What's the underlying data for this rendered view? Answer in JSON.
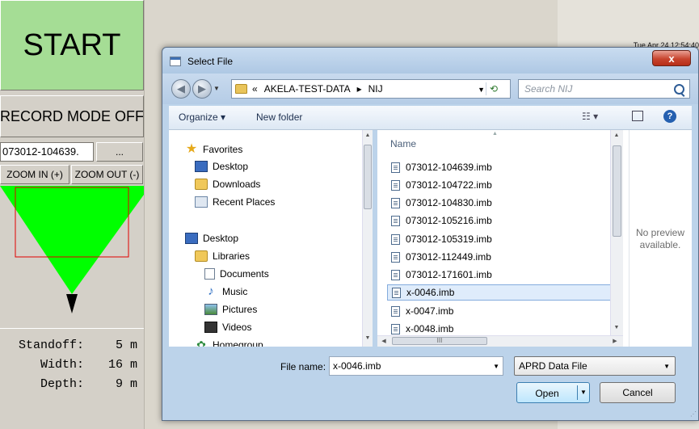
{
  "background_app": {
    "start_label": "START",
    "record_mode_label": "RECORD MODE OFF",
    "file_field_value": "073012-104639.",
    "browse_label": "...",
    "zoom_in_label": "ZOOM IN (+)",
    "zoom_out_label": "ZOOM OUT (-)",
    "readouts": [
      {
        "label": "Standoff:",
        "value": "5 m"
      },
      {
        "label": "Width:",
        "value": "16 m"
      },
      {
        "label": "Depth:",
        "value": "9 m"
      }
    ],
    "clock": "Tue Apr 24 12:54:40",
    "colors": {
      "start_bg": "#a5dd95",
      "fov_fill": "#00ff00",
      "fov_box": "#e00000"
    }
  },
  "dialog": {
    "title": "Select File",
    "close_label": "x",
    "address": {
      "prefix": "«",
      "crumbs": [
        "AKELA-TEST-DATA",
        "NIJ"
      ],
      "separator": "▸"
    },
    "search_placeholder": "Search NIJ",
    "toolbar": {
      "organize_label": "Organize ▾",
      "new_folder_label": "New folder",
      "views_label": "☷ ▾",
      "help_label": "?"
    },
    "nav": {
      "favorites_label": "Favorites",
      "favorites": [
        "Desktop",
        "Downloads",
        "Recent Places"
      ],
      "desktop_label": "Desktop",
      "libraries_label": "Libraries",
      "libraries": [
        "Documents",
        "Music",
        "Pictures",
        "Videos"
      ],
      "homegroup_label": "Homegroup"
    },
    "column_name": "Name",
    "files": [
      "073012-104639.imb",
      "073012-104722.imb",
      "073012-104830.imb",
      "073012-105216.imb",
      "073012-105319.imb",
      "073012-112449.imb",
      "073012-171601.imb",
      "x-0046.imb",
      "x-0047.imb",
      "x-0048.imb"
    ],
    "selected_file": "x-0046.imb",
    "preview_line1": "No preview",
    "preview_line2": "available.",
    "file_name_label": "File name:",
    "file_name_value": "x-0046.imb",
    "file_type_value": "APRD Data File",
    "open_label": "Open",
    "cancel_label": "Cancel",
    "hscroll_label": "III"
  }
}
